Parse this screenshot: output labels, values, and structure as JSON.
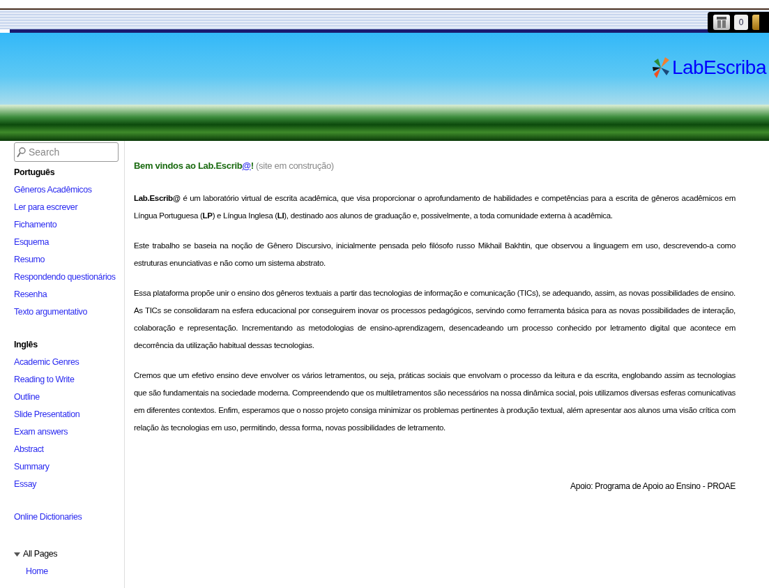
{
  "toolbar": {
    "count": "0"
  },
  "logo": {
    "text": "LabEscriba"
  },
  "sidebar": {
    "search": {
      "placeholder": "Search"
    },
    "sections": [
      {
        "heading": "Português",
        "items": [
          "Gêneros Acadêmicos",
          "Ler para escrever",
          "Fichamento",
          "Esquema",
          "Resumo",
          "Respondendo questionários",
          "Resenha",
          "Texto argumentativo"
        ]
      },
      {
        "heading": "Inglês",
        "items": [
          "Academic Genres",
          "Reading to Write",
          "Outline",
          "Slide Presentation",
          "Exam answers",
          "Abstract",
          "Summary",
          "Essay"
        ]
      }
    ],
    "extra_link": "Online Dictionaries",
    "all_pages": {
      "label": "All Pages",
      "expanded": true,
      "children": [
        {
          "label": "Home"
        }
      ]
    }
  },
  "welcome": {
    "title": "Bem vindos ao Lab.Escrib",
    "link": "@",
    "ending": "!",
    "note": " (site em construção)"
  },
  "paragraphs": [
    "**Lab.Escrib@** é um laboratório virtual de escrita acadêmica, que visa proporcionar o aprofundamento de habilidades e competências para a escrita de gêneros acadêmicos em Língua Portuguesa (**LP**) e Língua Inglesa (**LI**), destinado aos alunos de graduação e, possivelmente, a toda comunidade externa à acadêmica.",
    "Este trabalho se baseia na noção de Gênero Discursivo, inicialmente pensada pelo filósofo russo Mikhail Bakhtin, que observou a linguagem em uso, descrevendo-a como estruturas enunciativas e não como um sistema abstrato.",
    "Essa plataforma propõe unir o ensino dos gêneros textuais a partir das tecnologias de informação e comunicação (TICs), se adequando, assim, as novas possibilidades de ensino. As TICs se consolidaram na esfera educacional por conseguirem inovar os processos pedagógicos, servindo como ferramenta básica para as novas possibilidades de interação, colaboração e representação. Incrementando as metodologias de ensino-aprendizagem, desencadeando um processo conhecido por letramento digital que acontece em decorrência da utilização habitual dessas tecnologias.",
    "Cremos que um efetivo ensino deve envolver os vários letramentos, ou seja, práticas sociais que envolvam o processo da leitura e da escrita, englobando assim as tecnologias que são fundamentais na sociedade moderna. Compreendendo que os multiletramentos são necessários na nossa dinâmica social, pois utilizamos diversas esferas comunicativas em diferentes contextos. Enfim, esperamos que o nosso projeto consiga minimizar os problemas pertinentes à produção textual, além apresentar aos alunos uma visão crítica com relação às tecnologias em uso, permitindo, dessa forma, novas possibilidades de letramento."
  ],
  "footer": "Apoio: Programa de Apoio ao Ensino - PROAE"
}
